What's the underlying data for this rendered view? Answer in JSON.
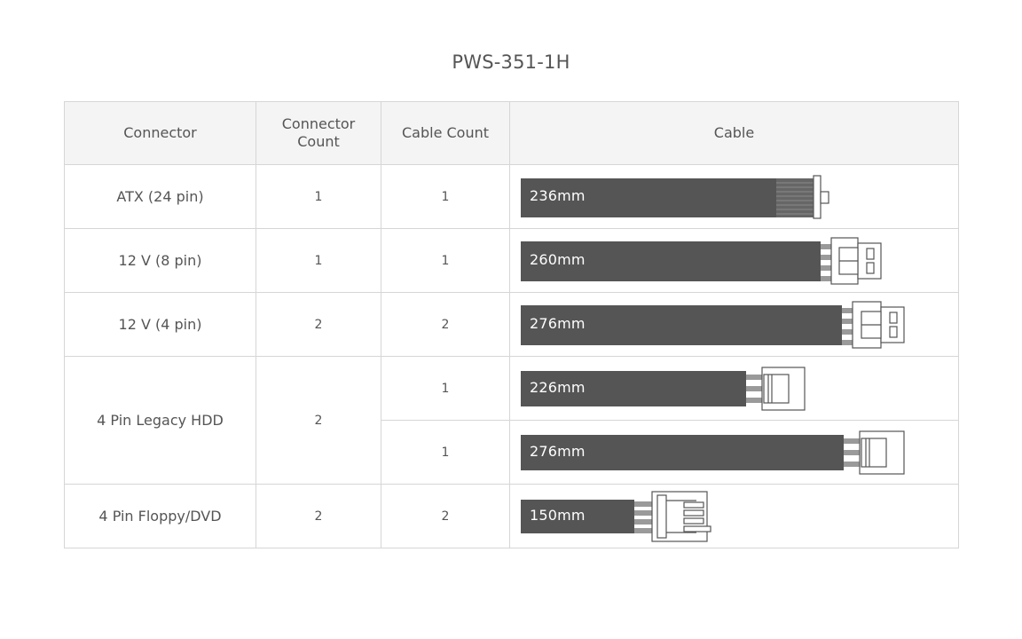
{
  "title": "PWS-351-1H",
  "columns": {
    "connector": "Connector",
    "connector_count": "Connector Count",
    "cable_count": "Cable Count",
    "cable": "Cable"
  },
  "rows": [
    {
      "connector": "ATX (24 pin)",
      "connector_count": "1",
      "cable_count": "1",
      "cable_length": "236mm",
      "plug": "atx-24pin-connector-icon"
    },
    {
      "connector": "12 V (8 pin)",
      "connector_count": "1",
      "cable_count": "1",
      "cable_length": "260mm",
      "plug": "eps-8pin-connector-icon"
    },
    {
      "connector": "12 V (4 pin)",
      "connector_count": "2",
      "cable_count": "2",
      "cable_length": "276mm",
      "plug": "atx-4pin-connector-icon"
    },
    {
      "connector": "4 Pin Legacy HDD",
      "connector_count": "2",
      "cable_count": "1",
      "cable_length": "226mm",
      "plug": "molex-connector-icon"
    },
    {
      "cable_count": "1",
      "cable_length": "276mm",
      "plug": "molex-connector-icon"
    },
    {
      "connector": "4 Pin Floppy/DVD",
      "connector_count": "2",
      "cable_count": "2",
      "cable_length": "150mm",
      "plug": "floppy-connector-icon"
    }
  ],
  "colors": {
    "cable": "#555555",
    "header_bg": "#f4f4f4",
    "border": "#d6d6d6",
    "text": "#555555"
  }
}
